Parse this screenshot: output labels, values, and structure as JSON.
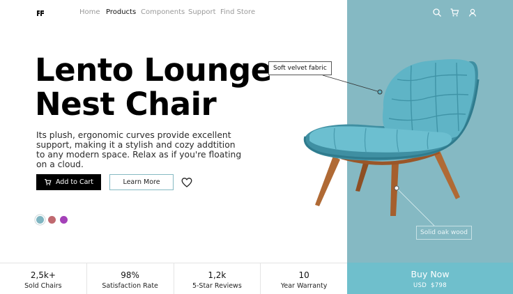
{
  "brand": {
    "logo_icon": "logo-mark-icon"
  },
  "nav": {
    "items": [
      {
        "label": "Home",
        "active": false
      },
      {
        "label": "Products",
        "active": true
      },
      {
        "label": "Components",
        "active": false
      },
      {
        "label": "Support",
        "active": false
      },
      {
        "label": "Find Store",
        "active": false
      }
    ]
  },
  "header_icons": [
    "search-icon",
    "cart-icon",
    "user-icon"
  ],
  "hero": {
    "title_line1": "Lento Lounge",
    "title_line2": "Nest Chair",
    "description": "Its plush, ergonomic curves provide excellent support, making it a stylish and cozy addtition to any modern space. Relax as if you're floating on a cloud.",
    "add_to_cart_label": "Add to Cart",
    "learn_more_label": "Learn More",
    "wishlist_icon": "heart-icon"
  },
  "colors": {
    "panel": "#85b9c3",
    "buy_bar": "#6fbfcc",
    "swatches": [
      "#7fb5c1",
      "#c0696f",
      "#a441b8"
    ],
    "selected_swatch": 0
  },
  "callouts": {
    "fabric": "Soft velvet fabric",
    "wood": "Solid oak wood"
  },
  "stats": [
    {
      "value": "2,5k+",
      "label": "Sold Chairs"
    },
    {
      "value": "98%",
      "label": "Satisfaction Rate"
    },
    {
      "value": "1,2k",
      "label": "5-Star Reviews"
    },
    {
      "value": "10",
      "label": "Year Warranty"
    }
  ],
  "buy": {
    "label": "Buy Now",
    "currency": "USD",
    "price": "$798"
  }
}
